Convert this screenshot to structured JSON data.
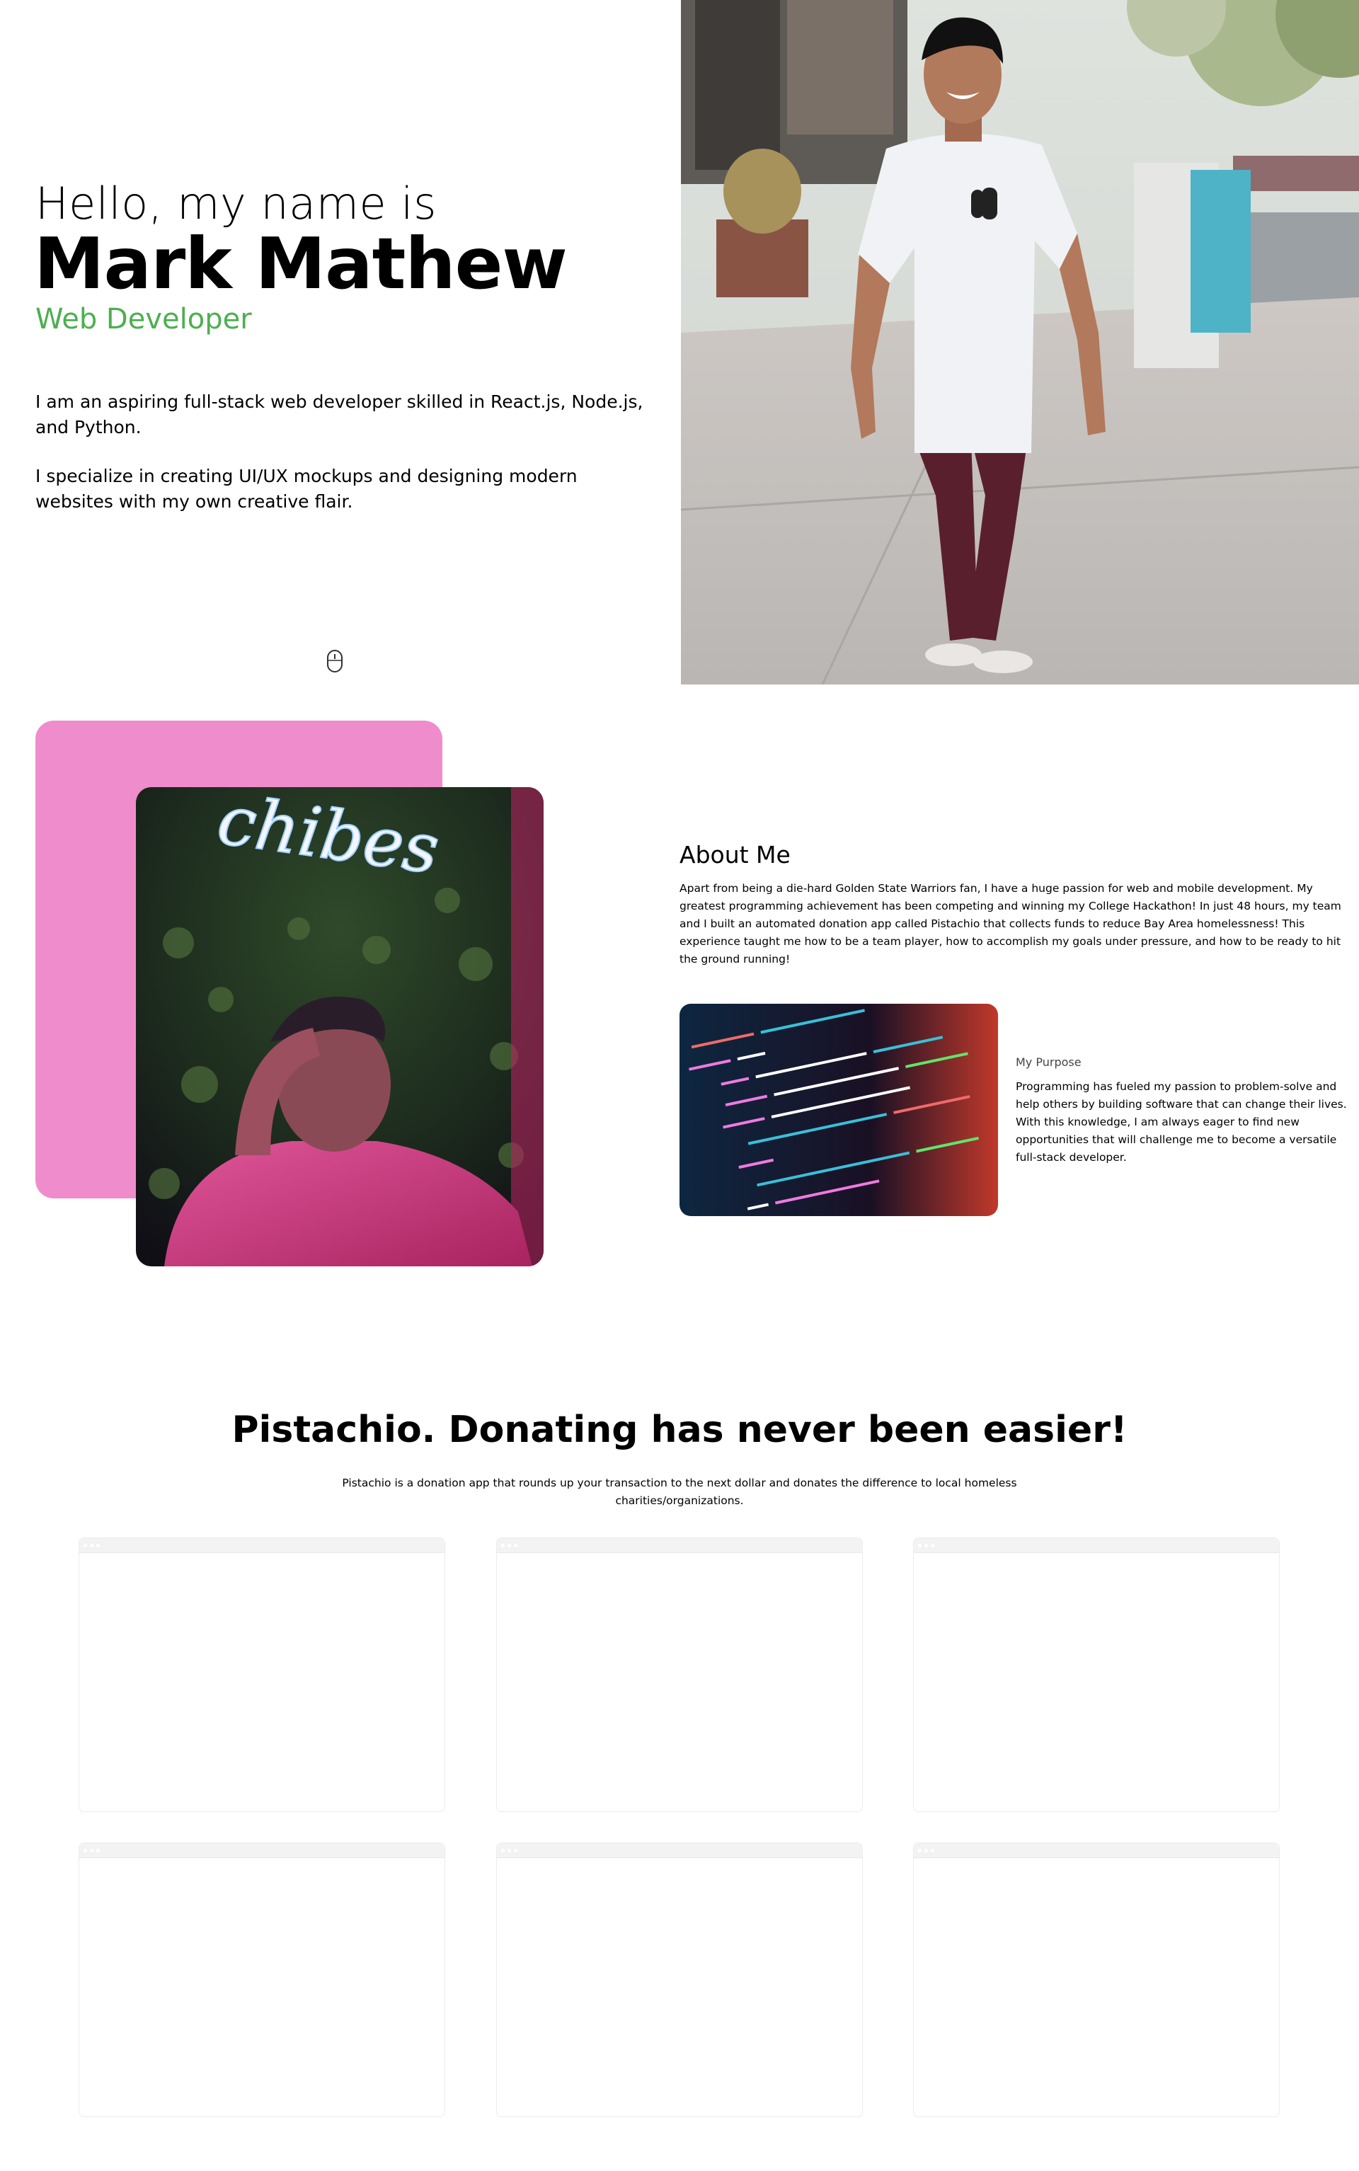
{
  "hero": {
    "greeting": "Hello, my name is",
    "name": "Mark Mathew",
    "role": "Web Developer",
    "intro_1": "I am an aspiring full-stack web developer skilled in React.js, Node.js, and Python.",
    "intro_2": "I specialize in creating UI/UX mockups and designing modern websites with my own creative flair.",
    "scroll_icon": "mouse-scroll-icon"
  },
  "about": {
    "title": "About Me",
    "body": "Apart from being a die-hard Golden State Warriors fan, I have a huge passion for web and mobile development. My greatest programming achievement has been competing and winning my College Hackathon! In just 48 hours, my team and I built an automated donation app called Pistachio that collects funds to reduce Bay Area homelessness! This experience taught me how to be a team player, how to accomplish my goals under pressure, and how to be ready to hit the ground running!",
    "purpose_title": "My Purpose",
    "purpose_body": "Programming has fueled my passion to problem-solve and help others by building software that can change their lives. With this knowledge, I am always eager to find new opportunities that will challenge me to become a versatile full-stack developer.",
    "neon_sign": "chibes"
  },
  "project": {
    "title": "Pistachio. Donating has never been easier!",
    "description": "Pistachio is a donation app that rounds up your transaction to the next dollar and donates the difference to local homeless charities/organizations."
  },
  "colors": {
    "accent_green": "#4caf50",
    "pink_block": "#ef8dcc"
  }
}
